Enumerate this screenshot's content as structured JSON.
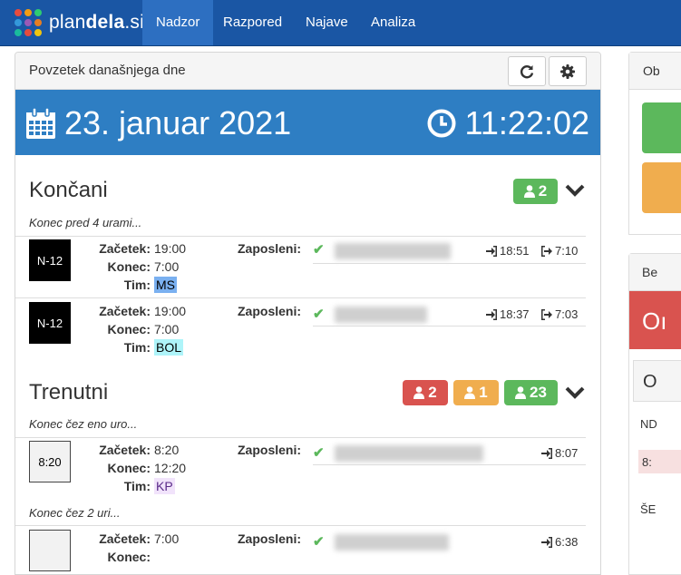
{
  "brand": {
    "name_light": "plan",
    "name_bold": "dela",
    "name_suffix": ".si"
  },
  "nav": [
    {
      "label": "Nadzor",
      "active": true
    },
    {
      "label": "Razpored",
      "active": false
    },
    {
      "label": "Najave",
      "active": false
    },
    {
      "label": "Analiza",
      "active": false
    }
  ],
  "panel": {
    "title": "Povzetek današnjega dne",
    "refresh_icon": "refresh-icon",
    "settings_icon": "gear-icon"
  },
  "banner": {
    "date": "23. januar 2021",
    "time": "11:22:02"
  },
  "sections": {
    "koncani": {
      "title": "Končani",
      "badge": "2",
      "note": "Konec pred 4 urami...",
      "rows": [
        {
          "code": "N-12",
          "start": "19:00",
          "end": "7:00",
          "team": "MS",
          "team_color": "#7ab0f0",
          "check_in": "18:51",
          "check_out": "7:10"
        },
        {
          "code": "N-12",
          "start": "19:00",
          "end": "7:00",
          "team": "BOL",
          "team_color": "#aef4f9",
          "check_in": "18:37",
          "check_out": "7:03"
        }
      ]
    },
    "trenutni": {
      "title": "Trenutni",
      "badges": {
        "red": "2",
        "orange": "1",
        "green": "23"
      },
      "note1": "Konec čez eno uro...",
      "note2": "Konec čez 2 uri...",
      "rows": [
        {
          "code": "8:20",
          "start": "8:20",
          "end": "12:20",
          "team": "KP",
          "team_color": "#f1e3fb",
          "check_in": "8:07"
        },
        {
          "start": "7:00",
          "check_in": "6:38"
        }
      ]
    }
  },
  "labels": {
    "start": "Začetek:",
    "end": "Konec:",
    "team": "Tim:",
    "employees": "Zaposleni:"
  },
  "side": {
    "top_text": "Ob",
    "bottom_text": "Be",
    "big_text": "Oı",
    "q_text": "O",
    "nd_text": "ND",
    "nd_val": "8:",
    "se_text": "ŠE"
  },
  "colors": {
    "nav": "#1a56a4",
    "banner": "#2e7ec3",
    "green": "#5cb85c",
    "orange": "#f0ad4e",
    "red": "#d9534f"
  }
}
